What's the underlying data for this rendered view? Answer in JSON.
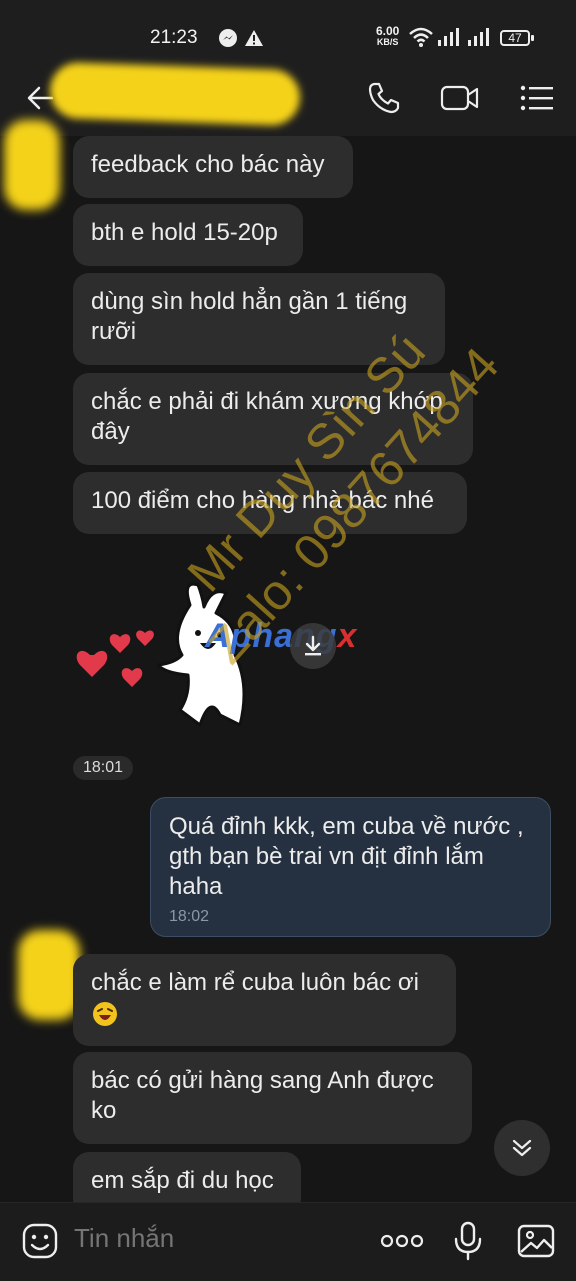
{
  "status_bar": {
    "time": "21:23",
    "net_speed_value": "6.00",
    "net_speed_unit": "KB/S",
    "battery": "47"
  },
  "header": {
    "icons": [
      "back-arrow-icon",
      "phone-icon",
      "video-call-icon",
      "menu-icon"
    ]
  },
  "messages": [
    {
      "sender": "other",
      "text": "feedback cho bác này"
    },
    {
      "sender": "other",
      "text": "bth e hold 15-20p"
    },
    {
      "sender": "other",
      "text": "dùng sìn hold hẳn gần 1 tiếng rưỡi"
    },
    {
      "sender": "other",
      "text": "chắc e phải đi khám xương khớp đây"
    },
    {
      "sender": "other",
      "text": "100 điểm cho hàng nhà bác nhé"
    },
    {
      "sender": "other",
      "type": "sticker",
      "sticker_watermark": "Aphang",
      "sticker_watermark_accent": "x"
    },
    {
      "type": "time_chip",
      "text": "18:01"
    },
    {
      "sender": "me",
      "text": "Quá đỉnh kkk, em cuba về nước , gth bạn bè trai vn địt đỉnh lắm haha",
      "time": "18:02"
    },
    {
      "sender": "other",
      "text": "chắc e làm rể cuba luôn bác ơi",
      "emoji": "laughing-face"
    },
    {
      "sender": "other",
      "text": "bác có gửi hàng sang Anh được ko"
    },
    {
      "sender": "other",
      "text": "em sắp đi du học"
    }
  ],
  "watermark": {
    "line1": "Mr Duy Sìn Sú",
    "line2": "Zalo: 0987674844",
    "color": "#c6a020"
  },
  "composer": {
    "placeholder": "Tin nhắn",
    "icons": [
      "emoji-icon",
      "more-dots-icon",
      "microphone-icon",
      "image-icon"
    ]
  },
  "colors": {
    "background": "#161616",
    "bubble_other": "#2d2d2d",
    "bubble_mine": "#253140",
    "redaction": "#f5d21a"
  }
}
